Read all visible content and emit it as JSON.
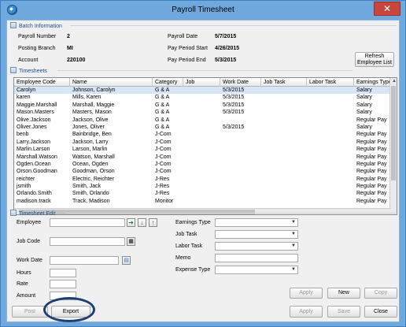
{
  "window": {
    "title": "Payroll Timesheet",
    "close_glyph": "✕"
  },
  "batch": {
    "section_label": "Batch Information",
    "payroll_number_label": "Payroll Number",
    "payroll_number": "2",
    "posting_branch_label": "Posting Branch",
    "posting_branch": "MI",
    "account_label": "Account",
    "account": "220100",
    "payroll_date_label": "Payroll Date",
    "payroll_date": "5/7/2015",
    "period_start_label": "Pay Period Start",
    "period_start": "4/26/2015",
    "period_end_label": "Pay Period End",
    "period_end": "5/3/2015",
    "refresh_label_1": "Refresh",
    "refresh_label_2": "Employee List"
  },
  "timesheets": {
    "section_label": "Timesheets",
    "columns": [
      "Employee Code",
      "Name",
      "Category",
      "Job",
      "Work Date",
      "Job Task",
      "Labor Task",
      "Earnings Type"
    ],
    "rows": [
      [
        "Carolyn",
        "Johnson, Carolyn",
        "G & A",
        "",
        "5/3/2015",
        "",
        "",
        "Salary"
      ],
      [
        "karen",
        "Mills, Karen",
        "G & A",
        "",
        "5/3/2015",
        "",
        "",
        "Salary"
      ],
      [
        "Maggie.Marshall",
        "Marshall, Maggie",
        "G & A",
        "",
        "5/3/2015",
        "",
        "",
        "Salary"
      ],
      [
        "Mason.Masters",
        "Masters, Mason",
        "G & A",
        "",
        "5/3/2015",
        "",
        "",
        "Salary"
      ],
      [
        "Olive.Jackson",
        "Jackson, Olive",
        "G & A",
        "",
        "",
        "",
        "",
        "Regular Pay"
      ],
      [
        "Oliver.Jones",
        "Jones, Oliver",
        "G & A",
        "",
        "5/3/2015",
        "",
        "",
        "Salary"
      ],
      [
        "benb",
        "Bainbridge, Ben",
        "J-Com",
        "",
        "",
        "",
        "",
        "Regular Pay"
      ],
      [
        "Larry.Jackson",
        "Jackson, Larry",
        "J-Com",
        "",
        "",
        "",
        "",
        "Regular Pay"
      ],
      [
        "Marlin.Larson",
        "Larson, Marlin",
        "J-Com",
        "",
        "",
        "",
        "",
        "Regular Pay"
      ],
      [
        "Marshall.Watson",
        "Watson, Marshall",
        "J-Com",
        "",
        "",
        "",
        "",
        "Regular Pay"
      ],
      [
        "Ogden.Ocean",
        "Ocean, Ogden",
        "J-Com",
        "",
        "",
        "",
        "",
        "Regular Pay"
      ],
      [
        "Orson.Goodman",
        "Goodman, Orson",
        "J-Com",
        "",
        "",
        "",
        "",
        "Regular Pay"
      ],
      [
        "reichter",
        "Electric, Reichter",
        "J-Res",
        "",
        "",
        "",
        "",
        "Regular Pay"
      ],
      [
        "jsmith",
        "Smith, Jack",
        "J-Res",
        "",
        "",
        "",
        "",
        "Regular Pay"
      ],
      [
        "Orlando.Smith",
        "Smith, Orlando",
        "J-Res",
        "",
        "",
        "",
        "",
        "Regular Pay"
      ],
      [
        "madison.track",
        "Track, Madison",
        "Monitor",
        "",
        "",
        "",
        "",
        "Regular Pay"
      ]
    ]
  },
  "edit": {
    "section_label": "Timesheet Edit",
    "employee_label": "Employee",
    "job_code_label": "Job Code",
    "work_date_label": "Work Date",
    "hours_label": "Hours",
    "rate_label": "Rate",
    "amount_label": "Amount",
    "earnings_type_label": "Earnings Type",
    "job_task_label": "Job Task",
    "labor_task_label": "Labor Task",
    "memo_label": "Memo",
    "expense_type_label": "Expense Type"
  },
  "buttons": {
    "apply_top": "Apply",
    "new": "New",
    "copy": "Copy",
    "post": "Post",
    "export": "Export",
    "apply_bottom": "Apply",
    "save": "Save",
    "close": "Close"
  },
  "colors": {
    "title_bar": "#6fa8dc",
    "section_text": "#1a4c8a",
    "highlight_ring": "#1e3f73"
  }
}
